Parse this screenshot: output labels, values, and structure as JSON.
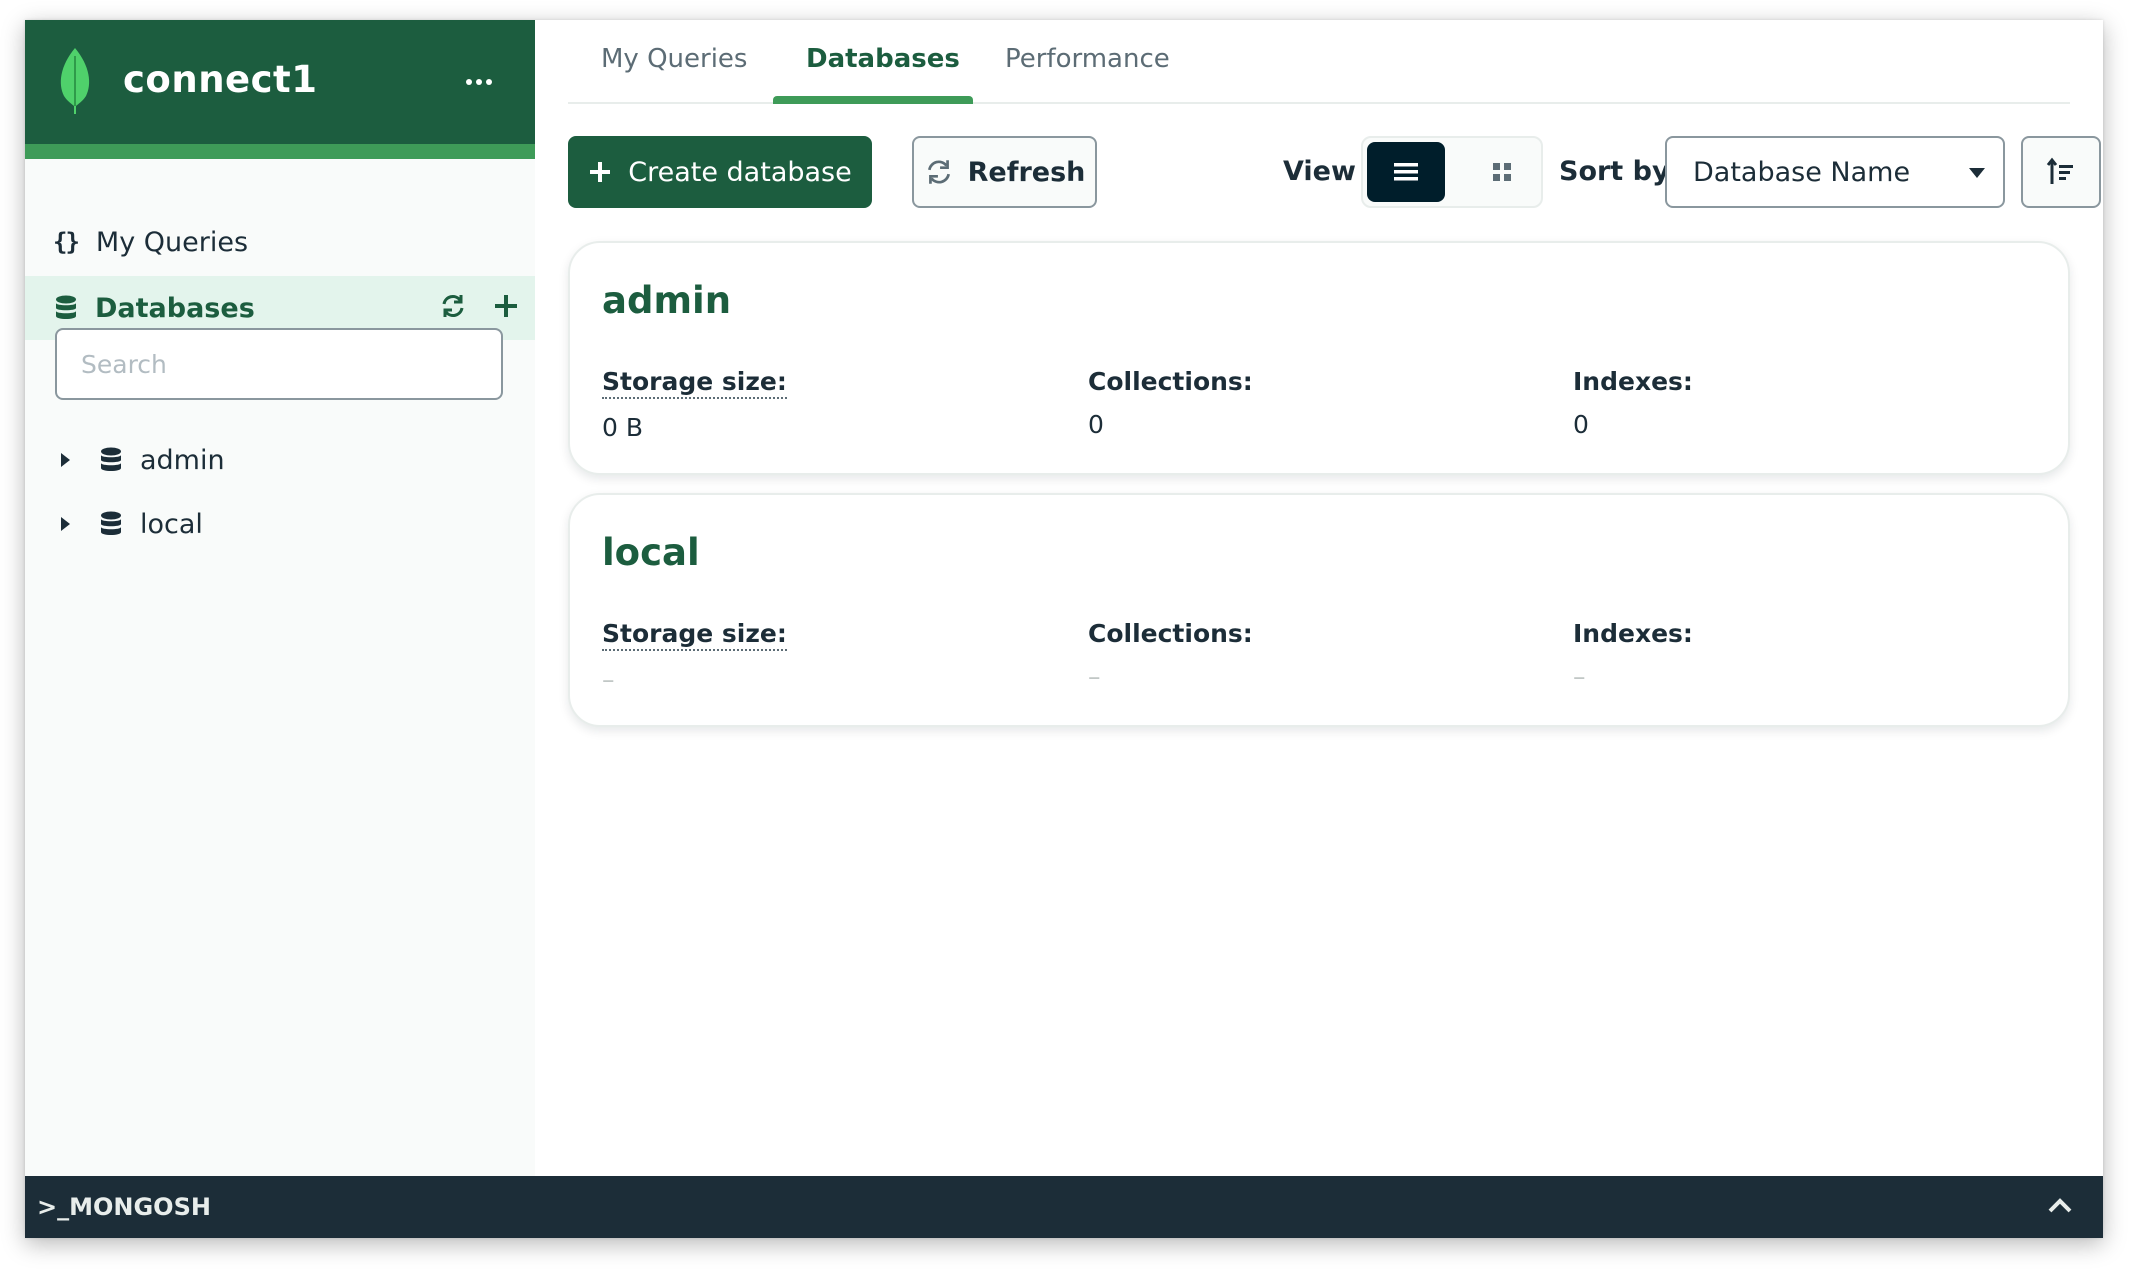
{
  "connection": {
    "name": "connect1",
    "icon": "mongodb-leaf-icon",
    "menu_icon": "ellipsis-icon"
  },
  "sidebar": {
    "my_queries_label": "My Queries",
    "databases_label": "Databases",
    "search_placeholder": "Search",
    "search_value": "",
    "tree": [
      {
        "label": "admin",
        "expanded": false
      },
      {
        "label": "local",
        "expanded": false
      }
    ]
  },
  "tabs": [
    {
      "label": "My Queries",
      "active": false
    },
    {
      "label": "Databases",
      "active": true
    },
    {
      "label": "Performance",
      "active": false
    }
  ],
  "toolbar": {
    "create_label": "Create database",
    "refresh_label": "Refresh",
    "view_label": "View",
    "view_mode": "list",
    "sort_label": "Sort by",
    "sort_value": "Database Name"
  },
  "databases": [
    {
      "name": "admin",
      "storage_label": "Storage size:",
      "storage_value": "0 B",
      "collections_label": "Collections:",
      "collections_value": "0",
      "indexes_label": "Indexes:",
      "indexes_value": "0"
    },
    {
      "name": "local",
      "storage_label": "Storage size:",
      "storage_value": "–",
      "collections_label": "Collections:",
      "collections_value": "–",
      "indexes_label": "Indexes:",
      "indexes_value": "–"
    }
  ],
  "shell": {
    "label": ">_MONGOSH"
  },
  "colors": {
    "brand_dark": "#1c5d3f",
    "brand_accent": "#3e9b58",
    "selected_bg": "#e3f4ec",
    "shell_bg": "#1c2d38"
  }
}
